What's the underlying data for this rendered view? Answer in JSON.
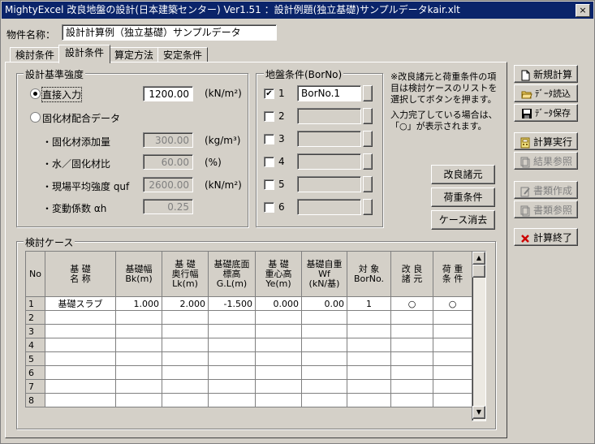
{
  "window": {
    "title": "MightyExcel 改良地盤の設計(日本建築センター) Ver1.51 ：設計例題(独立基礎)サンプルデータkair.xlt",
    "close": "×"
  },
  "header": {
    "name_label": "物件名称：",
    "name_value": "設計計算例（独立基礎）サンプルデータ"
  },
  "tabs": [
    "検討条件",
    "設計条件",
    "算定方法",
    "安定条件"
  ],
  "design_strength": {
    "group_title": "設計基準強度",
    "direct_input_label": "直接入力",
    "direct_input_value": "1200.00",
    "direct_input_unit": "(kN/m²)",
    "mix_label": "固化材配合データ",
    "rows": [
      {
        "label": "・固化材添加量",
        "value": "300.00",
        "unit": "(kg/m³)"
      },
      {
        "label": "・水／固化材比",
        "value": "60.00",
        "unit": "(%)"
      },
      {
        "label": "・現場平均強度 quf",
        "value": "2600.00",
        "unit": "(kN/m²)"
      },
      {
        "label": "・変動係数 αh",
        "value": "0.25",
        "unit": ""
      }
    ]
  },
  "ground": {
    "group_title": "地盤条件(BorNo)",
    "rows": [
      {
        "no": "1",
        "checked": true,
        "value": "BorNo.1"
      },
      {
        "no": "2",
        "checked": false,
        "value": ""
      },
      {
        "no": "3",
        "checked": false,
        "value": ""
      },
      {
        "no": "4",
        "checked": false,
        "value": ""
      },
      {
        "no": "5",
        "checked": false,
        "value": ""
      },
      {
        "no": "6",
        "checked": false,
        "value": ""
      }
    ]
  },
  "notes": {
    "note1": "※改良諸元と荷重条件の項目は検討ケースのリストを選択してボタンを押ます。",
    "note2": "入力完了している場合は、「○」が表示されます。"
  },
  "mid_buttons": {
    "improve": "改良諸元",
    "load": "荷重条件",
    "delete": "ケース消去"
  },
  "side_buttons": {
    "new": "新規計算",
    "read": "ﾃﾞｰﾀ読込",
    "save": "ﾃﾞｰﾀ保存",
    "calc": "計算実行",
    "result": "結果参照",
    "doc_make": "書類作成",
    "doc_view": "書類参照",
    "quit": "計算終了"
  },
  "cases": {
    "group_title": "検討ケース",
    "headers": [
      "No",
      "基 礎\n名 称",
      "基礎幅\nBk(m)",
      "基 礎\n奥行幅\nLk(m)",
      "基礎底面\n標高\nG.L(m)",
      "基 礎\n重心高\nYe(m)",
      "基礎自重\nWf\n(kN/基)",
      "対 象\nBorNo.",
      "改 良\n諸 元",
      "荷 重\n条 件"
    ],
    "rows": [
      [
        "1",
        "基礎スラブ",
        "1.000",
        "2.000",
        "-1.500",
        "0.000",
        "0.00",
        "1",
        "○",
        "○"
      ],
      [
        "2",
        "",
        "",
        "",
        "",
        "",
        "",
        "",
        "",
        ""
      ],
      [
        "3",
        "",
        "",
        "",
        "",
        "",
        "",
        "",
        "",
        ""
      ],
      [
        "4",
        "",
        "",
        "",
        "",
        "",
        "",
        "",
        "",
        ""
      ],
      [
        "5",
        "",
        "",
        "",
        "",
        "",
        "",
        "",
        "",
        ""
      ],
      [
        "6",
        "",
        "",
        "",
        "",
        "",
        "",
        "",
        "",
        ""
      ],
      [
        "7",
        "",
        "",
        "",
        "",
        "",
        "",
        "",
        "",
        ""
      ],
      [
        "8",
        "",
        "",
        "",
        "",
        "",
        "",
        "",
        "",
        ""
      ]
    ]
  },
  "colors": {
    "titlebar": "#0a246a",
    "face": "#d4d0c8",
    "check_red": "#cc0000"
  }
}
